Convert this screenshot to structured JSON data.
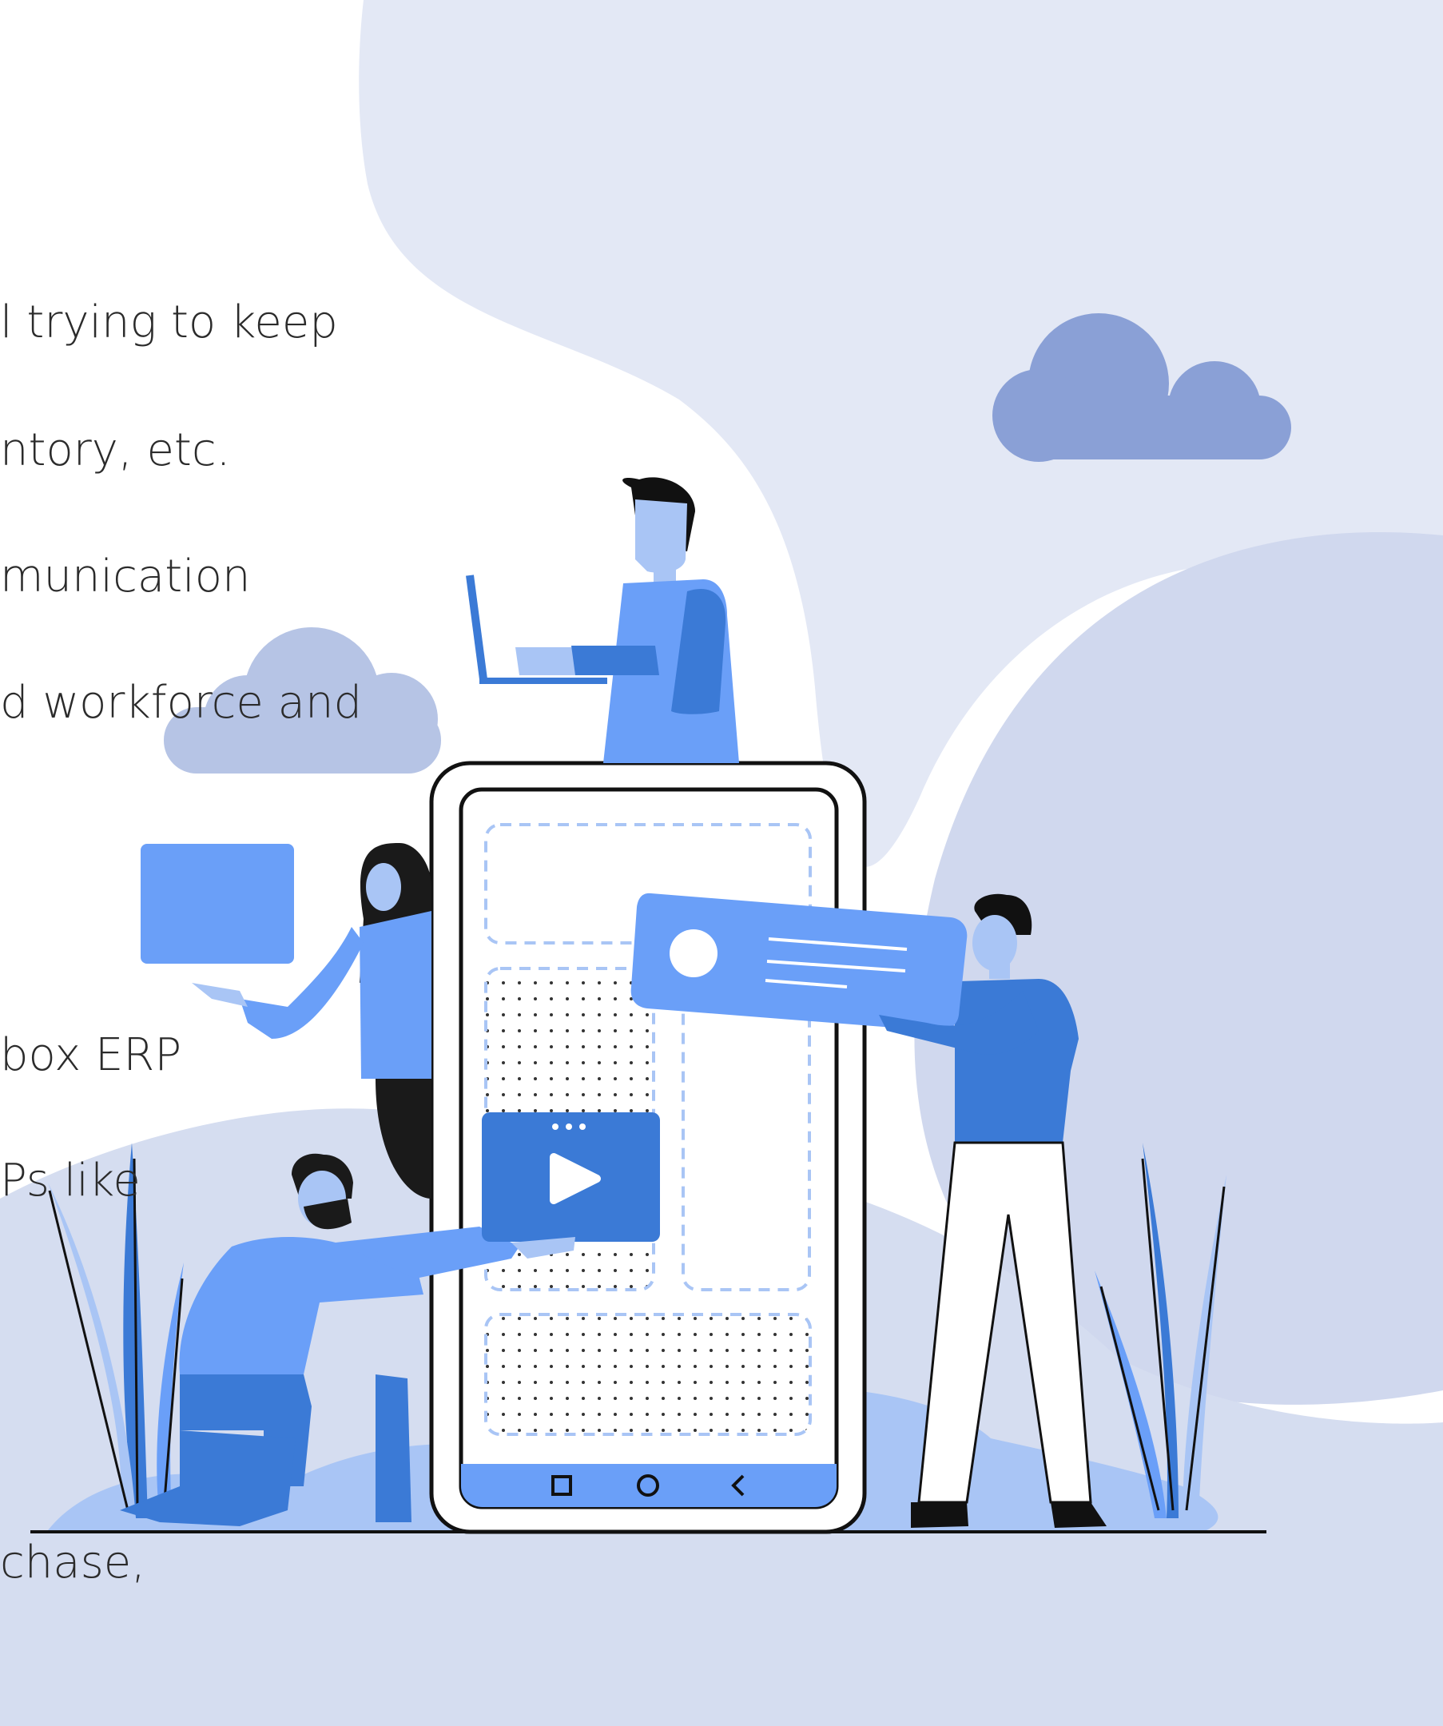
{
  "text_lines": [
    "l trying to keep",
    "ntory, etc.",
    "munication",
    "d workforce and",
    "box ERP",
    "Ps like",
    "chase,"
  ],
  "colors": {
    "background": "#ffffff",
    "blob_light": "#e3e8f5",
    "blob_mid": "#d0d8ee",
    "cloud_dark": "#8aa0d6",
    "cloud_light": "#b6c4e5",
    "blue_primary": "#6a9ff8",
    "blue_dark": "#3b7ad6",
    "blue_pale": "#a9c5f5",
    "outline": "#1a1a1a",
    "ground_line": "#111111"
  },
  "phone": {
    "nav_icons": [
      "square-nav-icon",
      "circle-nav-icon",
      "back-chevron-icon"
    ]
  }
}
